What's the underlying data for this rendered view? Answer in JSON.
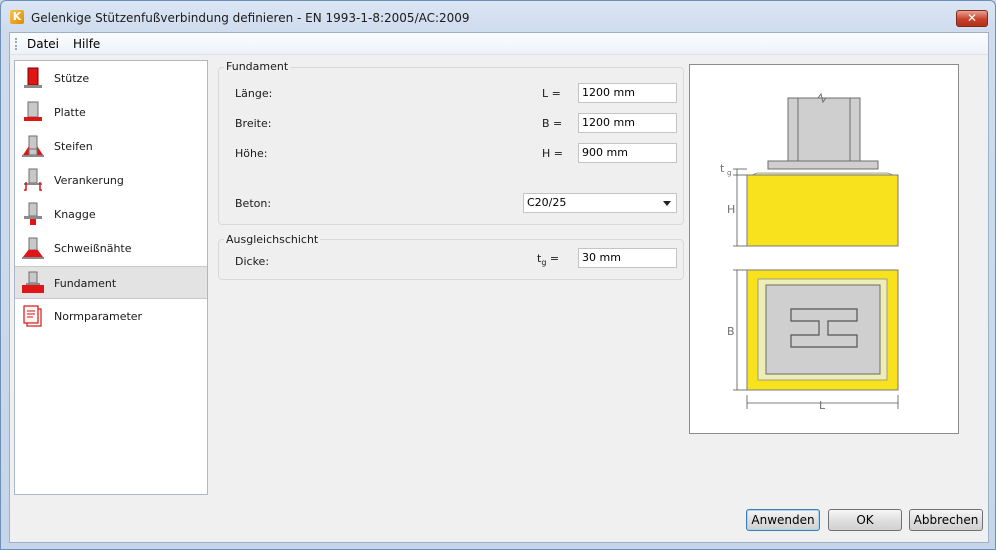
{
  "window": {
    "title": "Gelenkige Stützenfußverbindung definieren - EN 1993-1-8:2005/AC:2009",
    "app_icon_letter": "K",
    "close_glyph": "✕"
  },
  "menu": [
    "Datei",
    "Hilfe"
  ],
  "nav": {
    "items": [
      {
        "label": "Stütze",
        "icon": "column-icon"
      },
      {
        "label": "Platte",
        "icon": "plate-icon"
      },
      {
        "label": "Steifen",
        "icon": "stiffener-icon"
      },
      {
        "label": "Verankerung",
        "icon": "anchor-icon"
      },
      {
        "label": "Knagge",
        "icon": "shear-key-icon"
      },
      {
        "label": "Schweißnähte",
        "icon": "weld-icon"
      },
      {
        "label": "Fundament",
        "icon": "foundation-icon"
      },
      {
        "label": "Normparameter",
        "icon": "code-parameters-icon"
      }
    ],
    "selected": "Fundament"
  },
  "fundament": {
    "title": "Fundament",
    "length": {
      "label": "Länge:",
      "symbol": "L =",
      "value": "1200 mm"
    },
    "width": {
      "label": "Breite:",
      "symbol": "B =",
      "value": "1200 mm"
    },
    "height": {
      "label": "Höhe:",
      "symbol": "H =",
      "value": "900 mm"
    },
    "concrete": {
      "label": "Beton:",
      "value": "C20/25"
    }
  },
  "grout": {
    "title": "Ausgleichschicht",
    "thickness": {
      "label": "Dicke:",
      "symbol_main": "t",
      "symbol_sub": "g",
      "symbol_eq": " =",
      "value": "30 mm"
    }
  },
  "preview": {
    "label_tg": "t",
    "label_tg_sub": "g",
    "label_h": "H",
    "label_b": "B",
    "label_l": "L",
    "colors": {
      "concrete": "#f7e21d",
      "steel": "#cfcfcf"
    }
  },
  "buttons": {
    "apply": "Anwenden",
    "ok": "OK",
    "cancel": "Abbrechen"
  }
}
